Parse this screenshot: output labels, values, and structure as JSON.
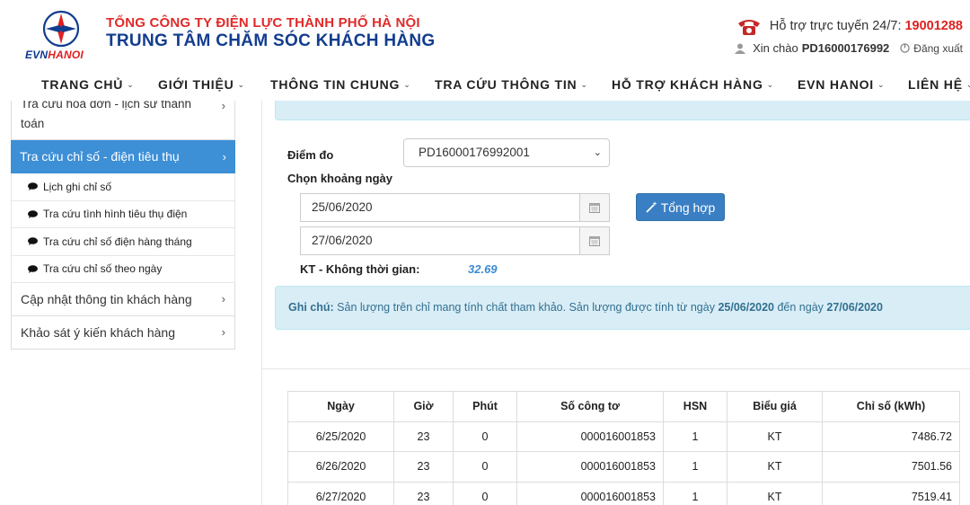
{
  "header": {
    "logo_text_evn": "EVN",
    "logo_text_hanoi": "HANOI",
    "corp_name": "TỔNG CÔNG TY ĐIỆN LỰC THÀNH PHỐ HÀ NỘI",
    "center_name": "TRUNG TÂM CHĂM SÓC KHÁCH HÀNG",
    "support_label": "Hỗ trợ trực tuyến 24/7:",
    "hotline": "19001288",
    "greeting": "Xin chào",
    "username": "PD16000176992",
    "logout_label": "Đăng xuất"
  },
  "nav": [
    {
      "label": "TRANG CHỦ"
    },
    {
      "label": "GIỚI THIỆU"
    },
    {
      "label": "THÔNG TIN CHUNG"
    },
    {
      "label": "TRA CỨU THÔNG TIN"
    },
    {
      "label": "HỖ TRỢ KHÁCH HÀNG"
    },
    {
      "label": "EVN HANOI"
    },
    {
      "label": "LIÊN HỆ"
    }
  ],
  "sidebar": {
    "top_item_line1": "Tra cứu hóa đơn - lịch sử thanh",
    "top_item_line2": "toán",
    "active_item": "Tra cứu chỉ số - điện tiêu thụ",
    "sub_items": [
      {
        "label": "Lịch ghi chỉ số"
      },
      {
        "label": "Tra cứu tình hình tiêu thụ điện"
      },
      {
        "label": "Tra cứu chỉ số điện hàng tháng"
      },
      {
        "label": "Tra cứu chỉ số theo ngày"
      }
    ],
    "items": [
      {
        "label": "Cập nhật thông tin khách hàng"
      },
      {
        "label": "Khảo sát ý kiến khách hàng"
      }
    ]
  },
  "form": {
    "meter_label": "Điểm đo",
    "meter_value": "PD16000176992001",
    "date_range_label": "Chọn khoảng ngày",
    "date_from": "25/06/2020",
    "date_to": "27/06/2020",
    "summary_button": "Tổng hợp",
    "kt_label": "KT - Không thời gian:",
    "kt_value": "32.69"
  },
  "note": {
    "prefix": "Ghi chú:",
    "text": " Sản lượng trên chỉ mang tính chất tham khảo. Sản lượng được tính từ ngày ",
    "from": "25/06/2020",
    "middle": " đến ngày ",
    "to": "27/06/2020"
  },
  "table": {
    "headers": [
      "Ngày",
      "Giờ",
      "Phút",
      "Số công tơ",
      "HSN",
      "Biểu giá",
      "Chỉ số (kWh)"
    ],
    "rows": [
      [
        "6/25/2020",
        "23",
        "0",
        "000016001853",
        "1",
        "KT",
        "7486.72"
      ],
      [
        "6/26/2020",
        "23",
        "0",
        "000016001853",
        "1",
        "KT",
        "7501.56"
      ],
      [
        "6/27/2020",
        "23",
        "0",
        "000016001853",
        "1",
        "KT",
        "7519.41"
      ]
    ]
  },
  "colors": {
    "brand_red": "#e02a2a",
    "brand_blue": "#123d8e",
    "active_blue": "#3d8fd6",
    "info_bg": "#d9edf7"
  }
}
